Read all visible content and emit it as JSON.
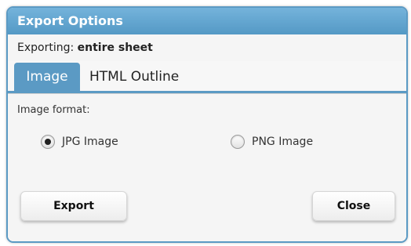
{
  "dialog": {
    "title": "Export Options",
    "status_prefix": "Exporting:",
    "status_value": "entire sheet"
  },
  "tabs": [
    {
      "label": "Image",
      "active": true
    },
    {
      "label": "HTML Outline",
      "active": false
    }
  ],
  "image_panel": {
    "format_label": "Image format:",
    "options": [
      {
        "label": "JPG Image",
        "selected": true
      },
      {
        "label": "PNG Image",
        "selected": false
      }
    ]
  },
  "buttons": {
    "export_label": "Export",
    "close_label": "Close"
  },
  "colors": {
    "accent": "#5b9ac4",
    "title_text": "#ffffff",
    "panel_bg": "#f5f5f5"
  }
}
